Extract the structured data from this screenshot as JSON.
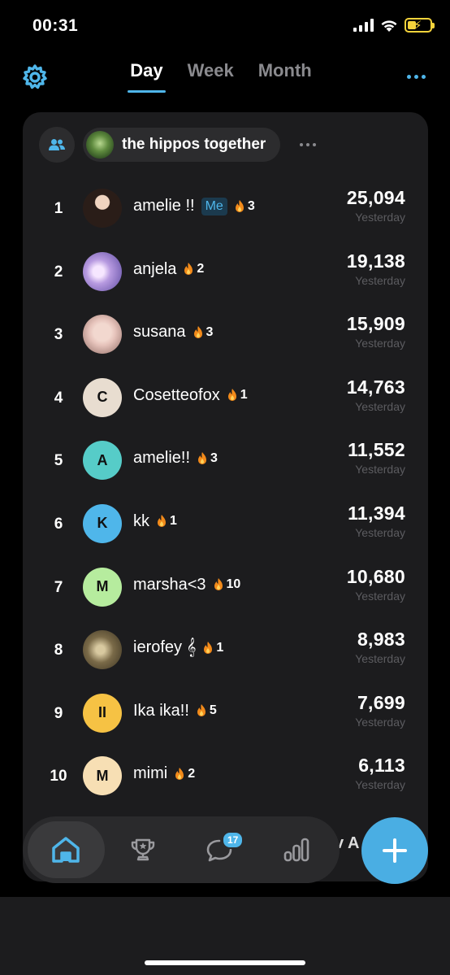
{
  "status_bar": {
    "time": "00:31"
  },
  "tabs": [
    {
      "label": "Day",
      "active": true
    },
    {
      "label": "Week",
      "active": false
    },
    {
      "label": "Month",
      "active": false
    }
  ],
  "group": {
    "name": "the hippos together"
  },
  "leaderboard": [
    {
      "rank": "1",
      "name": "amelie !!",
      "me": "Me",
      "streak": "3",
      "score": "25,094",
      "sub": "Yesterday",
      "avatar_type": "photo",
      "avatar_color": "#3a2a22"
    },
    {
      "rank": "2",
      "name": "anjela",
      "streak": "2",
      "score": "19,138",
      "sub": "Yesterday",
      "avatar_type": "photo",
      "avatar_color": "#c8a8e8"
    },
    {
      "rank": "3",
      "name": "susana",
      "streak": "3",
      "score": "15,909",
      "sub": "Yesterday",
      "avatar_type": "photo",
      "avatar_color": "#d9b8b0"
    },
    {
      "rank": "4",
      "name": "Cosetteofox",
      "streak": "1",
      "score": "14,763",
      "sub": "Yesterday",
      "avatar_type": "letter",
      "letter": "C",
      "avatar_color": "#e8ddd0"
    },
    {
      "rank": "5",
      "name": "amelie!!",
      "streak": "3",
      "score": "11,552",
      "sub": "Yesterday",
      "avatar_type": "letter",
      "letter": "A",
      "avatar_color": "#56ccc8"
    },
    {
      "rank": "6",
      "name": "kk",
      "streak": "1",
      "score": "11,394",
      "sub": "Yesterday",
      "avatar_type": "letter",
      "letter": "K",
      "avatar_color": "#4fb6ea"
    },
    {
      "rank": "7",
      "name": "marsha<3",
      "streak": "10",
      "score": "10,680",
      "sub": "Yesterday",
      "avatar_type": "letter",
      "letter": "M",
      "avatar_color": "#b6ec9e"
    },
    {
      "rank": "8",
      "name": "ierofey 𝄞",
      "streak": "1",
      "score": "8,983",
      "sub": "Yesterday",
      "avatar_type": "photo",
      "avatar_color": "#6b5a3a"
    },
    {
      "rank": "9",
      "name": "Ika ika!!",
      "streak": "5",
      "score": "7,699",
      "sub": "Yesterday",
      "avatar_type": "letter",
      "letter": "II",
      "avatar_color": "#f6c244"
    },
    {
      "rank": "10",
      "name": "mimi",
      "streak": "2",
      "score": "6,113",
      "sub": "Yesterday",
      "avatar_type": "letter",
      "letter": "M",
      "avatar_color": "#f7dfb4"
    }
  ],
  "bottom_nav": {
    "items": [
      {
        "icon": "home-icon",
        "active": true
      },
      {
        "icon": "trophy-icon",
        "active": false
      },
      {
        "icon": "chat-icon",
        "active": false,
        "badge": "17"
      },
      {
        "icon": "stats-icon",
        "active": false
      }
    ],
    "behind_text": "v A"
  },
  "fab": {
    "icon": "plus-icon"
  },
  "colors": {
    "accent": "#4fb6ea",
    "card": "#1c1c1e",
    "background": "#000000"
  }
}
